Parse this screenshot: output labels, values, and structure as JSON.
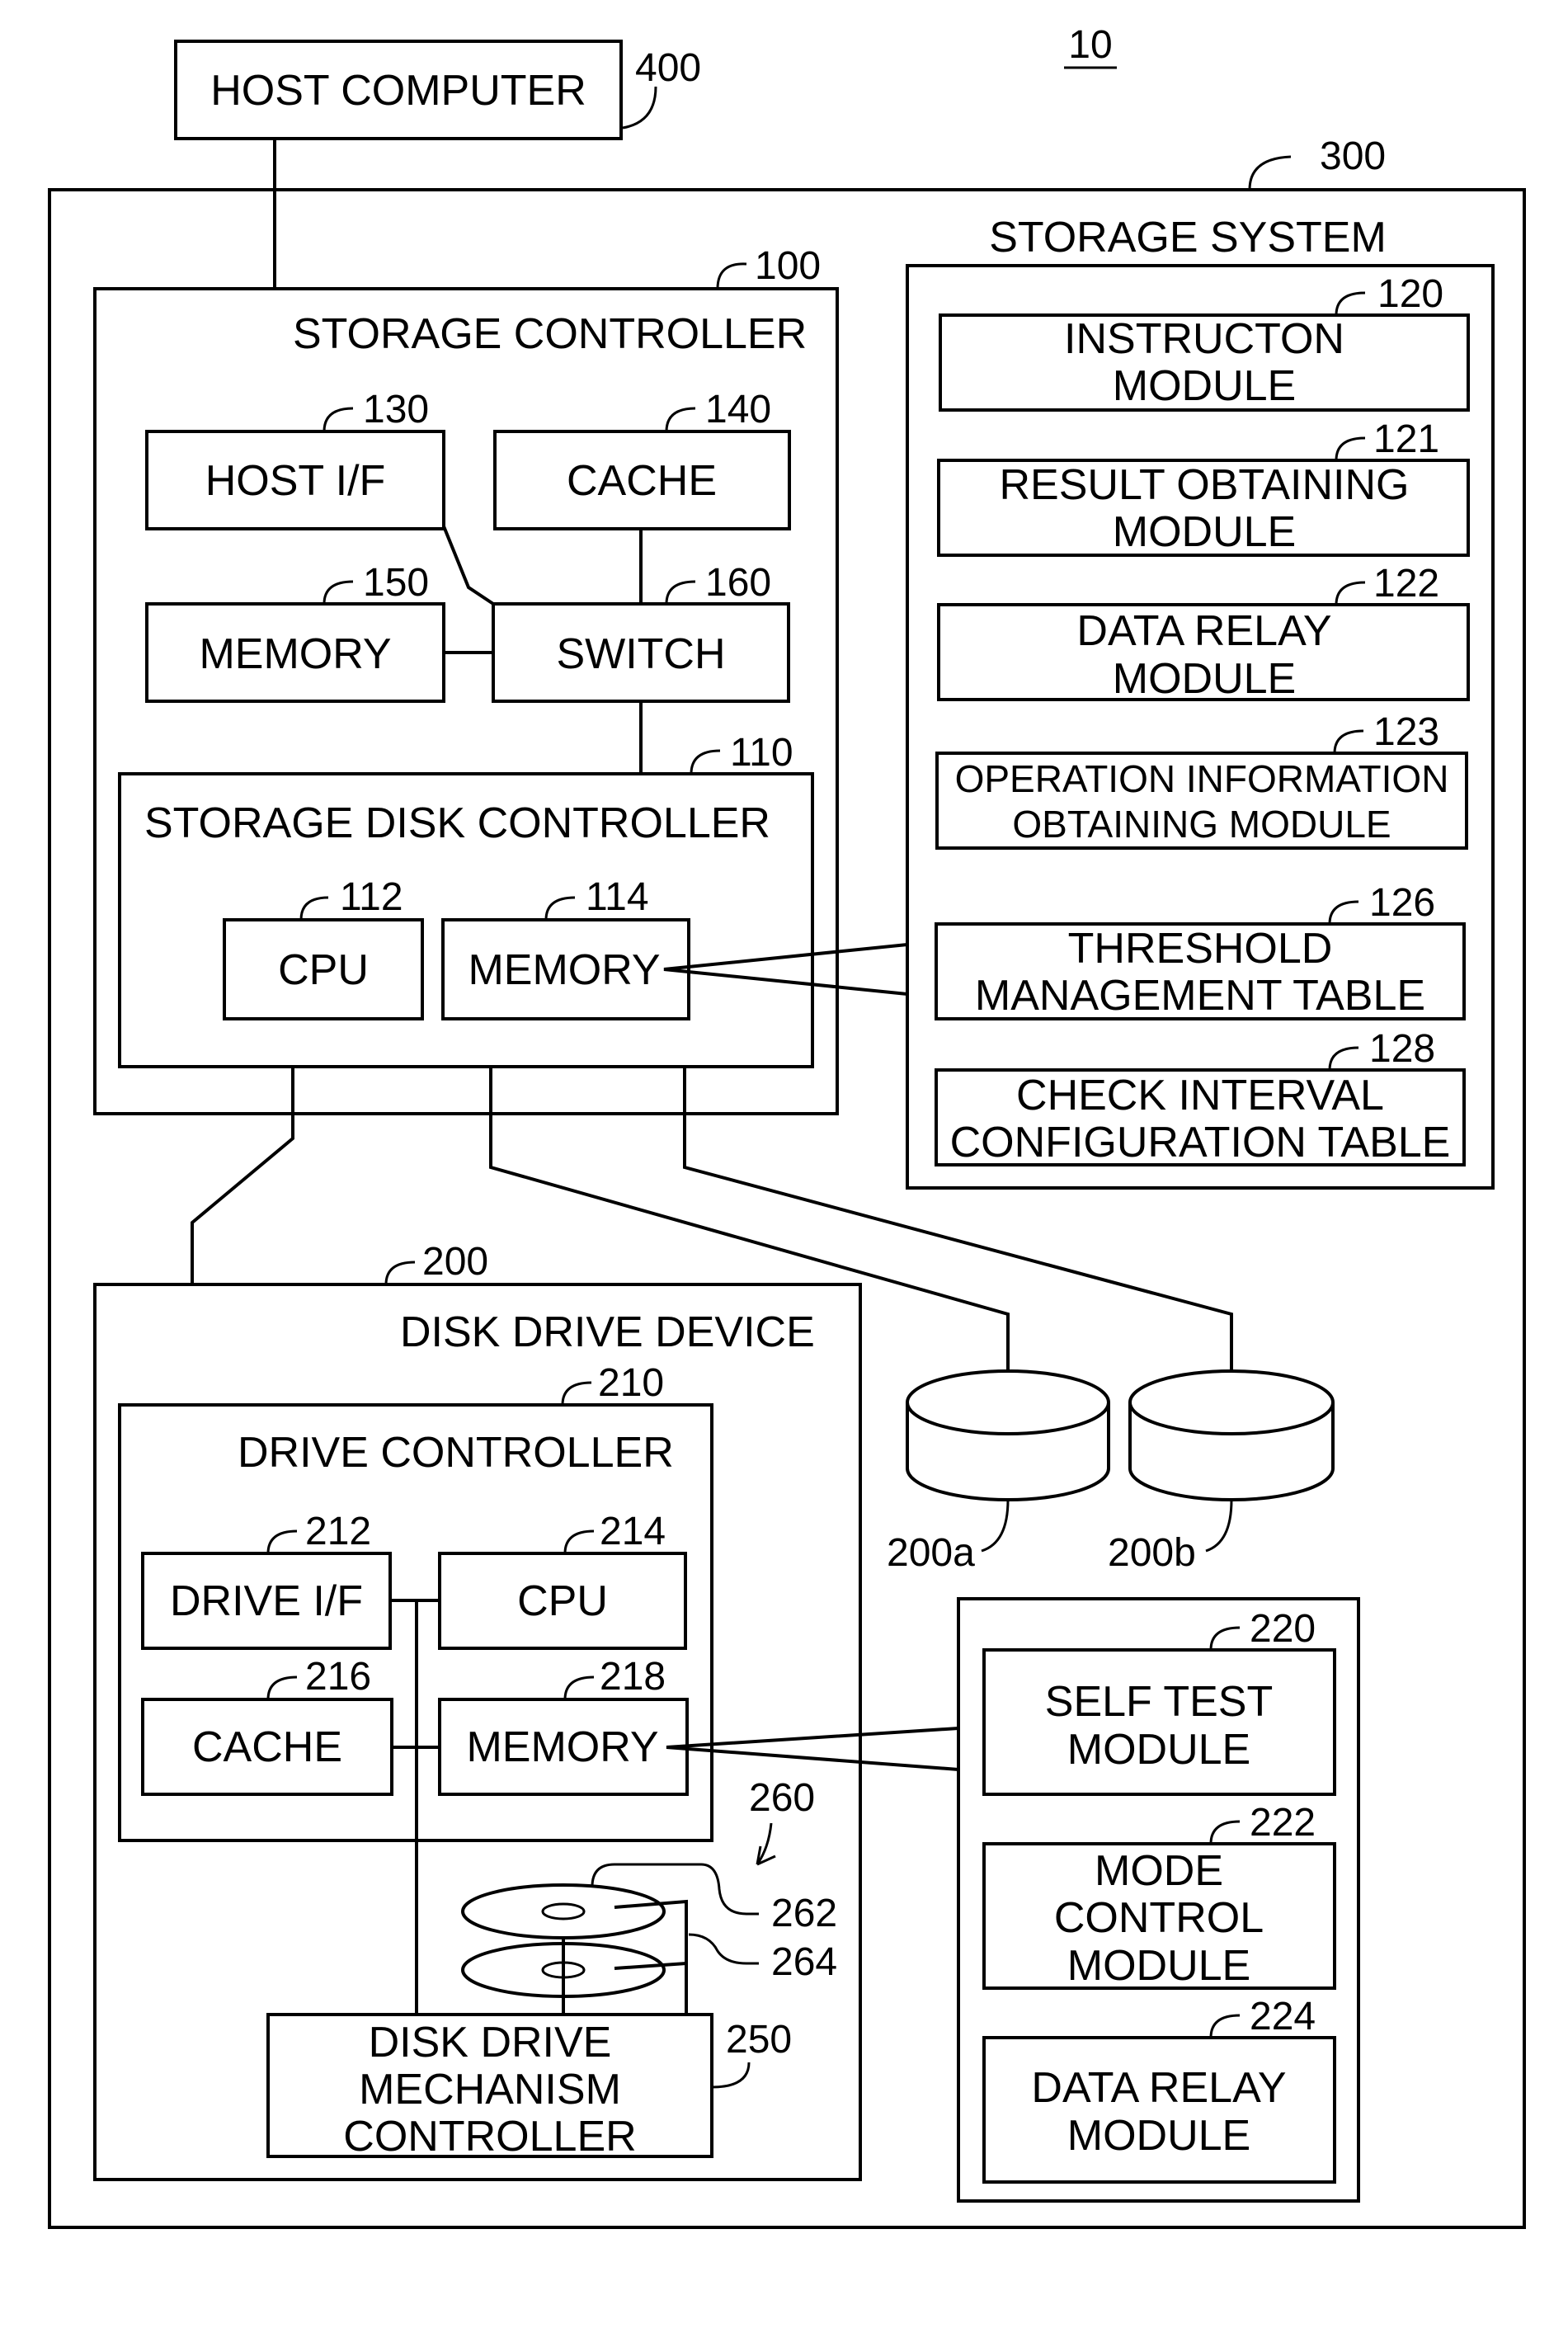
{
  "figure": {
    "number": "10",
    "host_computer": {
      "label": "HOST COMPUTER",
      "ref": "400"
    },
    "storage_system": {
      "label": "STORAGE SYSTEM",
      "ref": "300",
      "storage_controller": {
        "label": "STORAGE CONTROLLER",
        "ref": "100",
        "host_if": {
          "label": "HOST I/F",
          "ref": "130"
        },
        "cache": {
          "label": "CACHE",
          "ref": "140"
        },
        "memory": {
          "label": "MEMORY",
          "ref": "150"
        },
        "switch": {
          "label": "SWITCH",
          "ref": "160"
        },
        "storage_disk_controller": {
          "label": "STORAGE DISK CONTROLLER",
          "ref": "110",
          "cpu": {
            "label": "CPU",
            "ref": "112"
          },
          "memory": {
            "label": "MEMORY",
            "ref": "114"
          }
        }
      },
      "memory_contents": [
        {
          "lines": [
            "INSTRUCTON",
            "MODULE"
          ],
          "ref": "120"
        },
        {
          "lines": [
            "RESULT OBTAINING",
            "MODULE"
          ],
          "ref": "121"
        },
        {
          "lines": [
            "DATA RELAY",
            "MODULE"
          ],
          "ref": "122"
        },
        {
          "lines": [
            "OPERATION INFORMATION",
            "OBTAINING MODULE"
          ],
          "ref": "123"
        },
        {
          "lines": [
            "THRESHOLD",
            "MANAGEMENT TABLE"
          ],
          "ref": "126"
        },
        {
          "lines": [
            "CHECK INTERVAL",
            "CONFIGURATION TABLE"
          ],
          "ref": "128"
        }
      ],
      "disk_drive_device": {
        "label": "DISK DRIVE DEVICE",
        "ref": "200",
        "drive_controller": {
          "label": "DRIVE CONTROLLER",
          "ref": "210",
          "drive_if": {
            "label": "DRIVE I/F",
            "ref": "212"
          },
          "cpu": {
            "label": "CPU",
            "ref": "214"
          },
          "cache": {
            "label": "CACHE",
            "ref": "216"
          },
          "memory": {
            "label": "MEMORY",
            "ref": "218"
          }
        },
        "disk_assembly_ref": "260",
        "platter_ref": "262",
        "head_ref": "264",
        "mechanism_controller": {
          "lines": [
            "DISK DRIVE",
            "MECHANISM",
            "CONTROLLER"
          ],
          "ref": "250"
        }
      },
      "disks": [
        {
          "ref": "200a"
        },
        {
          "ref": "200b"
        }
      ],
      "drive_memory_contents": [
        {
          "lines": [
            "SELF TEST",
            "MODULE"
          ],
          "ref": "220"
        },
        {
          "lines": [
            "MODE",
            "CONTROL",
            "MODULE"
          ],
          "ref": "222"
        },
        {
          "lines": [
            "DATA RELAY",
            "MODULE"
          ],
          "ref": "224"
        }
      ]
    }
  }
}
